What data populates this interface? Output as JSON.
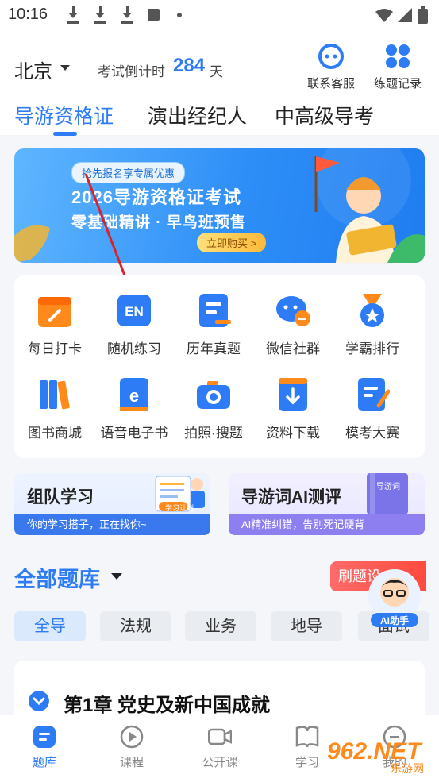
{
  "status_bar": {
    "time": "10:16"
  },
  "header": {
    "city": "北京",
    "countdown_label": "考试倒计时",
    "countdown_days": "284",
    "countdown_unit": "天",
    "contact_label": "联系客服",
    "records_label": "练题记录"
  },
  "tabs": [
    {
      "label": "导游资格证",
      "active": true
    },
    {
      "label": "演出经纪人",
      "active": false
    },
    {
      "label": "中高级导考",
      "active": false
    }
  ],
  "banner": {
    "pill": "抢先报名享专属优惠",
    "title": "2026导游资格证考试",
    "subtitle": "零基础精讲 · 早鸟班预售",
    "buy": "立即购买 >"
  },
  "grid": [
    {
      "label": "每日打卡",
      "icon": "calendar-icon",
      "color": "#ff8a1c"
    },
    {
      "label": "随机练习",
      "icon": "en-icon",
      "color": "#2d7cf6"
    },
    {
      "label": "历年真题",
      "icon": "document-icon",
      "color": "#2d7cf6"
    },
    {
      "label": "微信社群",
      "icon": "wechat-icon",
      "color": "#2d7cf6"
    },
    {
      "label": "学霸排行",
      "icon": "medal-icon",
      "color": "#2d7cf6"
    },
    {
      "label": "图书商城",
      "icon": "books-icon",
      "color": "#2d7cf6"
    },
    {
      "label": "语音电子书",
      "icon": "ebook-icon",
      "color": "#2d7cf6"
    },
    {
      "label": "拍照·搜题",
      "icon": "camera-icon",
      "color": "#2d7cf6"
    },
    {
      "label": "资料下载",
      "icon": "download-icon",
      "color": "#2d7cf6"
    },
    {
      "label": "模考大赛",
      "icon": "exam-icon",
      "color": "#2d7cf6"
    }
  ],
  "cards": {
    "team": {
      "title": "组队学习",
      "subtitle": "你的学习搭子，正在找你~",
      "badge": "学习计划"
    },
    "ai": {
      "title": "导游词AI测评",
      "subtitle": "AI精准纠错，告别死记硬背",
      "book_label": "导游词"
    }
  },
  "section": {
    "title": "全部题库",
    "practice": "刷题设"
  },
  "chips": [
    {
      "label": "全导",
      "active": true
    },
    {
      "label": "法规",
      "active": false
    },
    {
      "label": "业务",
      "active": false
    },
    {
      "label": "地导",
      "active": false
    },
    {
      "label": "面试",
      "active": false
    }
  ],
  "chapter": {
    "title": "第1章 党史及新中国成就"
  },
  "ai_helper": {
    "label": "AI助手"
  },
  "bottom_nav": [
    {
      "label": "题库",
      "icon": "question-bank-icon",
      "active": true
    },
    {
      "label": "课程",
      "icon": "play-icon",
      "active": false
    },
    {
      "label": "公开课",
      "icon": "video-icon",
      "active": false
    },
    {
      "label": "学习",
      "icon": "book-icon",
      "active": false
    },
    {
      "label": "我的",
      "icon": "profile-icon",
      "active": false
    }
  ],
  "watermark": {
    "text": "962.NET",
    "sub": "乐游网"
  },
  "colors": {
    "accent": "#2d7cf6",
    "orange": "#ff8a1c",
    "red": "#ff4a3d"
  }
}
